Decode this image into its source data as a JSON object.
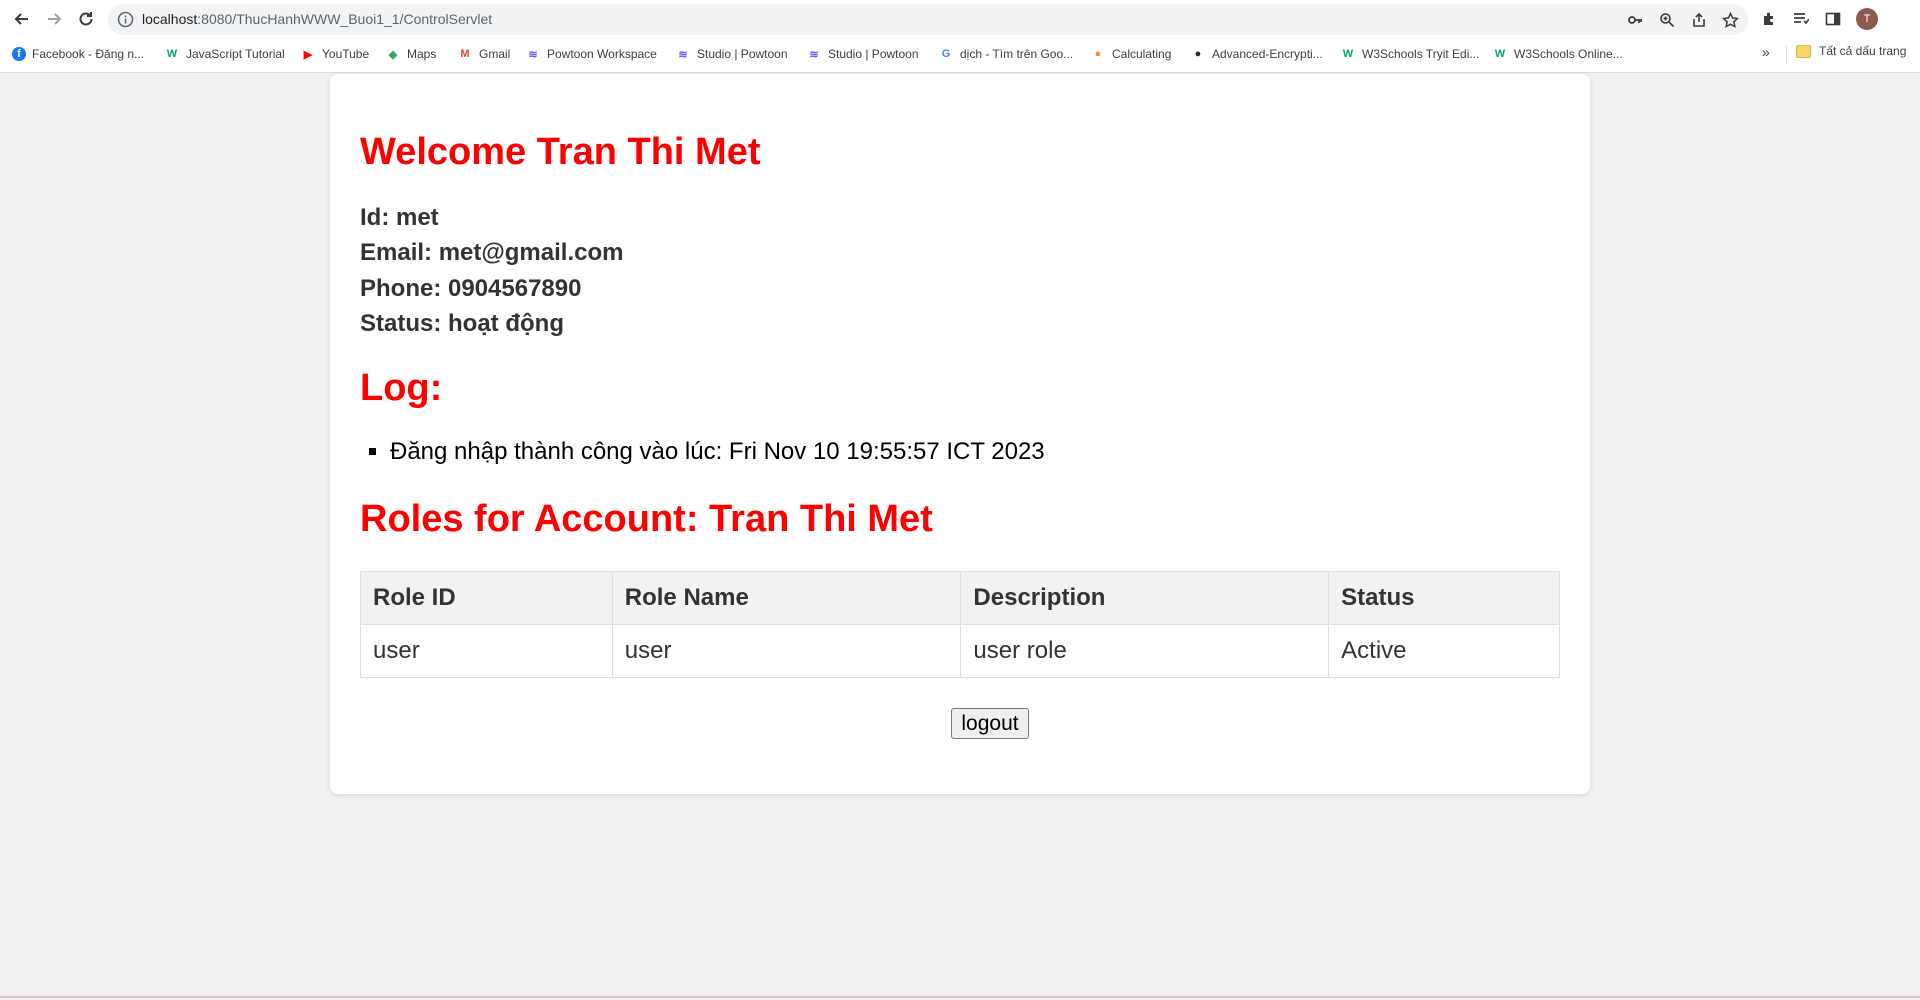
{
  "browser": {
    "url_host": "localhost",
    "url_path": ":8080/ThucHanhWWW_Buoi1_1/ControlServlet",
    "avatar_initial": "T",
    "bookmarks": [
      {
        "label": "Facebook - Đăng n...",
        "icon": "facebook-icon",
        "color": "#1877f2"
      },
      {
        "label": "JavaScript Tutorial",
        "icon": "w3schools-icon",
        "color": "#04aa6d"
      },
      {
        "label": "YouTube",
        "icon": "youtube-icon",
        "color": "#ff0000"
      },
      {
        "label": "Maps",
        "icon": "maps-icon",
        "color": "#34a853"
      },
      {
        "label": "Gmail",
        "icon": "gmail-icon",
        "color": "#ea4335"
      },
      {
        "label": "Powtoon Workspace",
        "icon": "powtoon-icon",
        "color": "#7b4dff"
      },
      {
        "label": "Studio | Powtoon",
        "icon": "powtoon-icon",
        "color": "#7b4dff"
      },
      {
        "label": "Studio | Powtoon",
        "icon": "powtoon-icon",
        "color": "#7b4dff"
      },
      {
        "label": "dịch - Tìm trên Goo...",
        "icon": "google-icon",
        "color": "#4285f4"
      },
      {
        "label": "Calculating",
        "icon": "pumpkin-icon",
        "color": "#f28c28"
      },
      {
        "label": "Advanced-Encrypti...",
        "icon": "github-icon",
        "color": "#24292f"
      },
      {
        "label": "W3Schools Tryit Edi...",
        "icon": "w3schools-icon",
        "color": "#04aa6d"
      },
      {
        "label": "W3Schools Online...",
        "icon": "w3schools-icon",
        "color": "#04aa6d"
      }
    ],
    "more_bookmarks": "»",
    "all_bookmarks_label": "Tất cả dấu trang"
  },
  "page": {
    "welcome_title": "Welcome Tran Thi Met",
    "id_line": "Id: met",
    "email_line": "Email: met@gmail.com",
    "phone_line": "Phone: 0904567890",
    "status_line": "Status: hoạt động",
    "log_heading": "Log:",
    "log_entries": [
      "Đăng nhập thành công vào lúc: Fri Nov 10 19:55:57 ICT 2023"
    ],
    "roles_heading": "Roles for Account: Tran Thi Met",
    "table": {
      "headers": [
        "Role ID",
        "Role Name",
        "Description",
        "Status"
      ],
      "rows": [
        [
          "user",
          "user",
          "user role",
          "Active"
        ]
      ]
    },
    "logout_label": "logout"
  },
  "colors": {
    "heading": "#ff0000",
    "text": "#333333",
    "background": "#f2f2f2",
    "card": "#ffffff"
  }
}
